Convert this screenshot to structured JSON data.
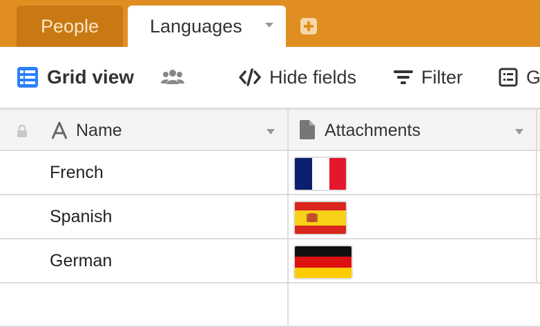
{
  "tabs": [
    {
      "label": "People",
      "active": false
    },
    {
      "label": "Languages",
      "active": true
    }
  ],
  "toolbar": {
    "view_label": "Grid view",
    "hide_fields_label": "Hide fields",
    "filter_label": "Filter",
    "group_label": "Gr"
  },
  "columns": [
    {
      "label": "Name",
      "icon": "text-a-icon"
    },
    {
      "label": "Attachments",
      "icon": "document-icon"
    }
  ],
  "rows": [
    {
      "name": "French",
      "attachment": "france-flag"
    },
    {
      "name": "Spanish",
      "attachment": "spain-flag"
    },
    {
      "name": "German",
      "attachment": "germany-flag"
    }
  ],
  "colors": {
    "tabbar": "#e08d22",
    "accent_blue": "#2d7ff9"
  }
}
